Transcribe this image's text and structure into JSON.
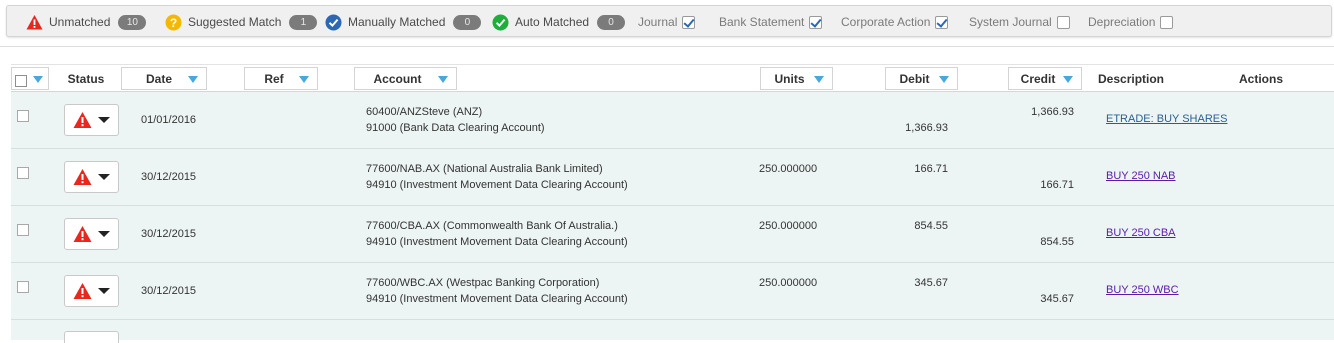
{
  "filters": {
    "unmatched": {
      "label": "Unmatched",
      "count": "10",
      "icon": "warning-icon"
    },
    "suggested": {
      "label": "Suggested Match",
      "count": "1",
      "icon": "question-icon"
    },
    "manual": {
      "label": "Manually Matched",
      "count": "0",
      "icon": "check-circle-blue-icon"
    },
    "auto": {
      "label": "Auto Matched",
      "count": "0",
      "icon": "check-circle-green-icon"
    },
    "sources": [
      {
        "label": "Journal",
        "checked": true
      },
      {
        "label": "Bank Statement",
        "checked": true
      },
      {
        "label": "Corporate Action",
        "checked": true
      },
      {
        "label": "System Journal",
        "checked": false
      },
      {
        "label": "Depreciation",
        "checked": false
      }
    ]
  },
  "table": {
    "columns": {
      "status": "Status",
      "date": "Date",
      "ref": "Ref",
      "account": "Account",
      "units": "Units",
      "debit": "Debit",
      "credit": "Credit",
      "description": "Description",
      "actions": "Actions"
    },
    "rows": [
      {
        "date": "01/01/2016",
        "account_line1": "60400/ANZSteve (ANZ)",
        "account_line2": "91000 (Bank Data Clearing Account)",
        "units": "",
        "debit_line1": "",
        "debit_line2": "1,366.93",
        "credit_line1": "1,366.93",
        "credit_line2": "",
        "description": "ETRADE: BUY SHARES",
        "link_style": "blue"
      },
      {
        "date": "30/12/2015",
        "account_line1": "77600/NAB.AX (National Australia Bank Limited)",
        "account_line2": "94910 (Investment Movement Data Clearing Account)",
        "units": "250.000000",
        "debit_line1": "166.71",
        "debit_line2": "",
        "credit_line1": "",
        "credit_line2": "166.71",
        "description": "BUY 250 NAB",
        "link_style": "purple"
      },
      {
        "date": "30/12/2015",
        "account_line1": "77600/CBA.AX (Commonwealth Bank Of Australia.)",
        "account_line2": "94910 (Investment Movement Data Clearing Account)",
        "units": "250.000000",
        "debit_line1": "854.55",
        "debit_line2": "",
        "credit_line1": "",
        "credit_line2": "854.55",
        "description": "BUY 250 CBA",
        "link_style": "purple"
      },
      {
        "date": "30/12/2015",
        "account_line1": "77600/WBC.AX (Westpac Banking Corporation)",
        "account_line2": "94910 (Investment Movement Data Clearing Account)",
        "units": "250.000000",
        "debit_line1": "345.67",
        "debit_line2": "",
        "credit_line1": "",
        "credit_line2": "345.67",
        "description": "BUY 250 WBC",
        "link_style": "purple"
      }
    ]
  },
  "colors": {
    "warning": "#e8281e",
    "question": "#f5b800",
    "manual": "#2c67b3",
    "auto": "#1fae3a",
    "row_bg": "#edf5f4",
    "sort_arrow": "#4aa7d9"
  }
}
